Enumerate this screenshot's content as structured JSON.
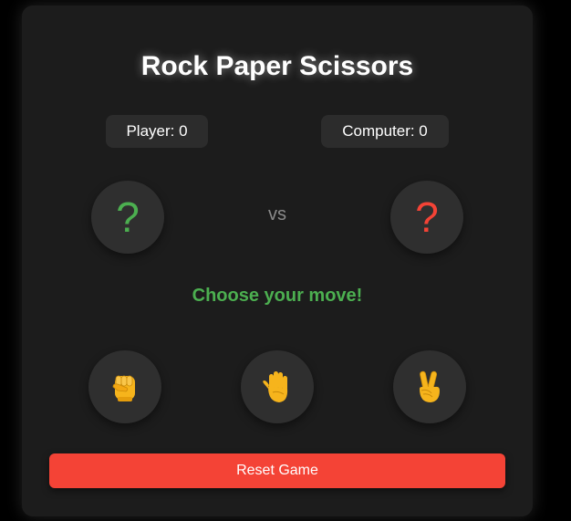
{
  "game": {
    "title": "Rock Paper Scissors"
  },
  "scores": {
    "player": "Player: 0",
    "computer": "Computer: 0"
  },
  "arena": {
    "player_hand": "?",
    "computer_hand": "?",
    "vs": "vs"
  },
  "status": {
    "message": "Choose your move!"
  },
  "choices": [
    {
      "name": "rock",
      "icon": "fist-icon"
    },
    {
      "name": "paper",
      "icon": "raised-hand-icon"
    },
    {
      "name": "scissors",
      "icon": "victory-hand-icon"
    }
  ],
  "controls": {
    "reset_label": "Reset Game"
  },
  "colors": {
    "background": "#1c1c1c",
    "player_accent": "#4caf50",
    "computer_accent": "#f44336",
    "reset_button": "#f44336",
    "hand_emoji": "#f6b41c"
  }
}
